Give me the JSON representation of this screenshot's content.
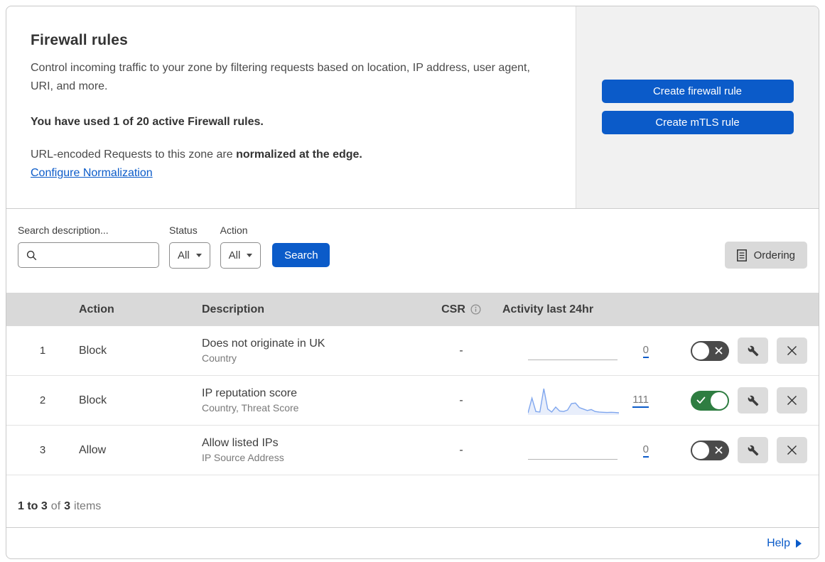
{
  "colors": {
    "accent_blue": "#0b5bc9",
    "toggle_on_green": "#2e7d41",
    "toggle_off_gray": "#4a4a4a",
    "side_panel_gray": "#f1f1f1",
    "table_header_gray": "#d9d9d9",
    "sparkline_blue": "#7fa6ee",
    "sparkline_fill": "#e8eefb"
  },
  "header": {
    "title": "Firewall rules",
    "description": "Control incoming traffic to your zone by filtering requests based on location, IP address, user agent, URI, and more.",
    "usage_line": "You have used 1 of 20 active Firewall rules.",
    "normalization_prefix": "URL-encoded Requests to this zone are ",
    "normalization_bold": "normalized at the edge.",
    "normalization_link": "Configure Normalization"
  },
  "side_panel": {
    "create_firewall_label": "Create firewall rule",
    "create_mtls_label": "Create mTLS rule"
  },
  "filters": {
    "search_label": "Search description...",
    "search_value": "",
    "status_label": "Status",
    "status_value": "All",
    "action_label": "Action",
    "action_value": "All",
    "search_button_label": "Search",
    "ordering_button_label": "Ordering"
  },
  "table": {
    "columns": {
      "action": "Action",
      "description": "Description",
      "csr": "CSR",
      "activity": "Activity last 24hr"
    },
    "rows": [
      {
        "num": "1",
        "action": "Block",
        "description": "Does not originate in UK",
        "criteria": "Country",
        "csr": "-",
        "activity_count": "0",
        "enabled": false,
        "sparkline": null
      },
      {
        "num": "2",
        "action": "Block",
        "description": "IP reputation score",
        "criteria": "Country, Threat Score",
        "csr": "-",
        "activity_count": "111",
        "enabled": true,
        "sparkline": [
          2,
          62,
          8,
          6,
          100,
          18,
          6,
          26,
          10,
          8,
          14,
          40,
          42,
          24,
          18,
          12,
          16,
          8,
          6,
          5,
          4,
          5,
          4,
          3
        ]
      },
      {
        "num": "3",
        "action": "Allow",
        "description": "Allow listed IPs",
        "criteria": "IP Source Address",
        "csr": "-",
        "activity_count": "0",
        "enabled": false,
        "sparkline": null
      }
    ],
    "footer": {
      "range": "1 to 3",
      "of_label": "of",
      "total": "3",
      "items_label": "items"
    }
  },
  "chart_data": {
    "type": "line",
    "title": "Activity last 24hr sparkline (rule 2)",
    "x": [
      0,
      1,
      2,
      3,
      4,
      5,
      6,
      7,
      8,
      9,
      10,
      11,
      12,
      13,
      14,
      15,
      16,
      17,
      18,
      19,
      20,
      21,
      22,
      23
    ],
    "values": [
      2,
      62,
      8,
      6,
      100,
      18,
      6,
      26,
      10,
      8,
      14,
      40,
      42,
      24,
      18,
      12,
      16,
      8,
      6,
      5,
      4,
      5,
      4,
      3
    ],
    "total": 111,
    "xlabel": "",
    "ylabel": "",
    "grid": false,
    "legend": false
  },
  "help": {
    "label": "Help"
  },
  "icons": [
    "search-icon",
    "chevron-down-icon",
    "ordering-list-icon",
    "info-icon",
    "wrench-icon",
    "close-icon",
    "toggle-x-icon",
    "toggle-check-icon",
    "help-arrow-icon"
  ]
}
